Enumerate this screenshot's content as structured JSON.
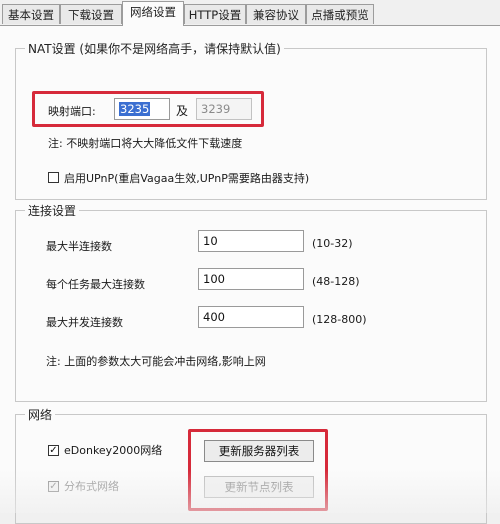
{
  "tabs": [
    {
      "label": "基本设置",
      "active": false
    },
    {
      "label": "下载设置",
      "active": false
    },
    {
      "label": "网络设置",
      "active": true
    },
    {
      "label": "HTTP设置",
      "active": false
    },
    {
      "label": "兼容协议",
      "active": false
    },
    {
      "label": "点播或预览",
      "active": false
    }
  ],
  "nat": {
    "legend": "NAT设置 (如果你不是网络高手，请保持默认值)",
    "port_label": "映射端口:",
    "port_value": "3235",
    "and_label": "及",
    "port2_value": "3239",
    "note": "注: 不映射端口将大大降低文件下载速度",
    "upnp_label": "启用UPnP(重启Vagaa生效,UPnP需要路由器支持)",
    "upnp_checked": false
  },
  "connection": {
    "legend": "连接设置",
    "rows": [
      {
        "label": "最大半连接数",
        "value": "10",
        "range": "(10-32)"
      },
      {
        "label": "每个任务最大连接数",
        "value": "100",
        "range": "(48-128)"
      },
      {
        "label": "最大并发连接数",
        "value": "400",
        "range": "(128-800)"
      }
    ],
    "note": "注: 上面的参数太大可能会冲击网络,影响上网"
  },
  "network": {
    "legend": "网络",
    "edonkey_label": "eDonkey2000网络",
    "edonkey_checked": true,
    "update_servers_button": "更新服务器列表",
    "distributed_label": "分布式网络",
    "distributed_checked": true,
    "update_nodes_button": "更新节点列表"
  },
  "colors": {
    "highlight_box": "#d62a3a",
    "selection": "#3b6fd1"
  }
}
